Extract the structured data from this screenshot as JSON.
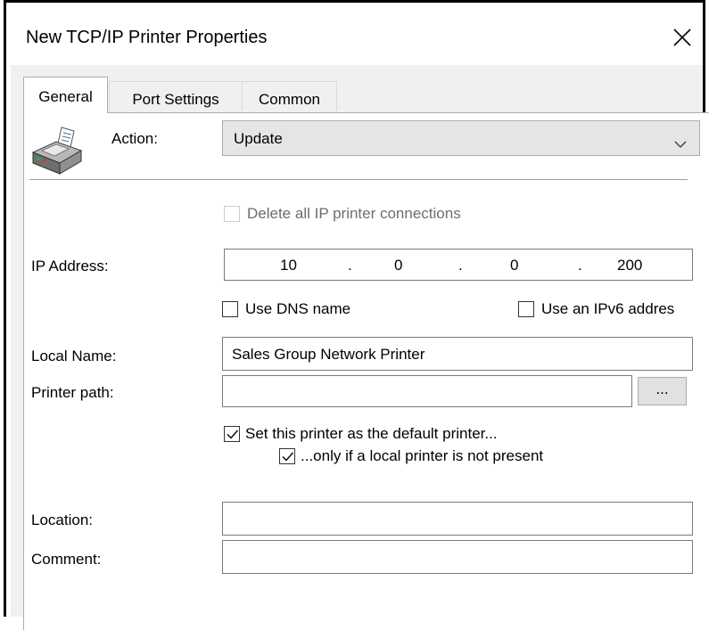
{
  "window": {
    "title": "New TCP/IP Printer Properties"
  },
  "tabs": [
    {
      "label": "General",
      "active": true
    },
    {
      "label": "Port Settings",
      "active": false
    },
    {
      "label": "Common",
      "active": false
    }
  ],
  "icons": {
    "printer": "printer-icon",
    "close": "close-icon",
    "dropdown": "chevron-down-icon"
  },
  "action": {
    "label": "Action:",
    "value": "Update"
  },
  "delete_all": {
    "label": "Delete all IP printer connections",
    "checked": false,
    "disabled": true
  },
  "ip_address": {
    "label": "IP Address:",
    "octets": [
      "10",
      "0",
      "0",
      "200"
    ],
    "dot": "."
  },
  "use_dns": {
    "label": "Use DNS name",
    "checked": false
  },
  "use_ipv6": {
    "label": "Use an IPv6 addres",
    "checked": false
  },
  "local_name": {
    "label": "Local Name:",
    "value": "Sales Group Network Printer"
  },
  "printer_path": {
    "label": "Printer path:",
    "value": "",
    "browse_label": "..."
  },
  "set_default": {
    "label": "Set this printer as the default printer...",
    "checked": true
  },
  "only_if_local": {
    "label": "...only if a local printer is not present",
    "checked": true
  },
  "location": {
    "label": "Location:",
    "value": ""
  },
  "comment": {
    "label": "Comment:",
    "value": ""
  }
}
